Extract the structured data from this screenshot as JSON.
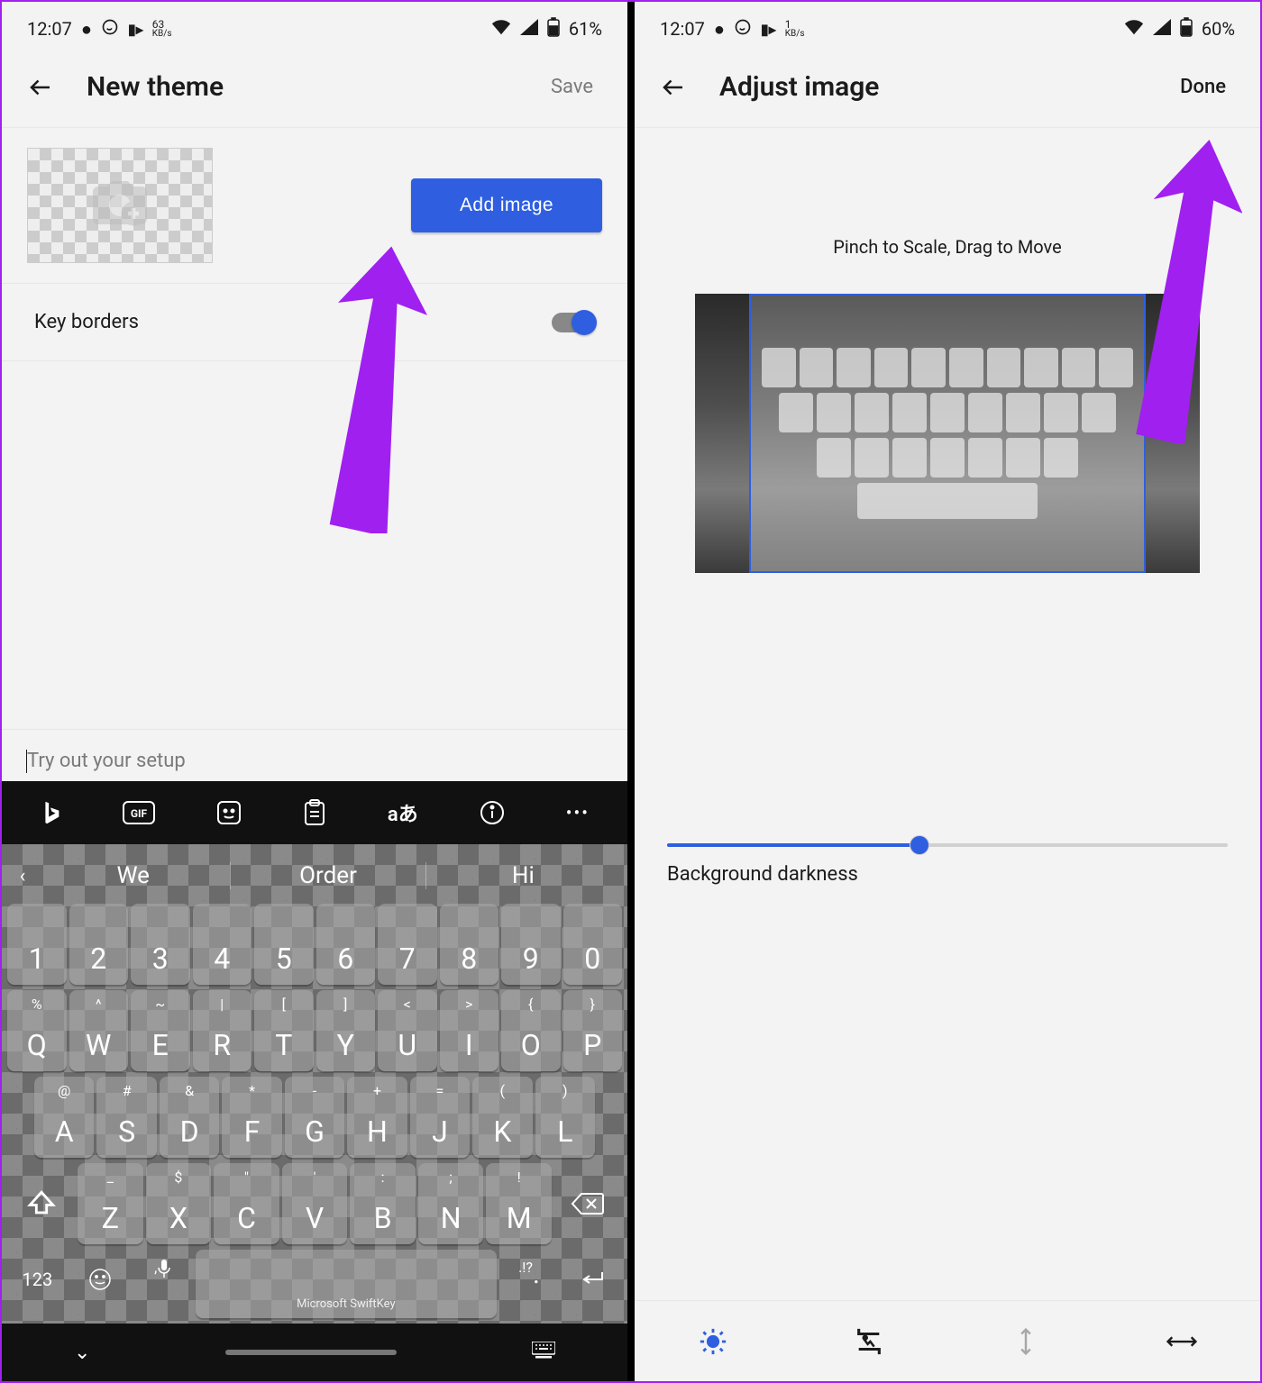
{
  "left": {
    "status": {
      "time": "12:07",
      "speed_top": "63",
      "speed_unit": "KB/s",
      "battery": "61%"
    },
    "appbar": {
      "title": "New theme",
      "action": "Save"
    },
    "addImage": {
      "button": "Add image"
    },
    "keyBorders": {
      "label": "Key borders"
    },
    "tryout": {
      "placeholder": "Try out your setup"
    },
    "suggestions": [
      "We",
      "Order",
      "Hi"
    ],
    "rowNums": [
      "1",
      "2",
      "3",
      "4",
      "5",
      "6",
      "7",
      "8",
      "9",
      "0"
    ],
    "rowQ_sub": [
      "%",
      "^",
      "~",
      "|",
      "[",
      "]",
      "<",
      ">",
      "{",
      "}"
    ],
    "rowQ": [
      "Q",
      "W",
      "E",
      "R",
      "T",
      "Y",
      "U",
      "I",
      "O",
      "P"
    ],
    "rowA_sub": [
      "@",
      "#",
      "&",
      "*",
      "-",
      "+",
      "=",
      "(",
      ")"
    ],
    "rowA": [
      "A",
      "S",
      "D",
      "F",
      "G",
      "H",
      "J",
      "K",
      "L"
    ],
    "rowZ_sub": [
      "_",
      "$",
      "\"",
      "'",
      ":",
      ";",
      "!",
      "?"
    ],
    "rowZ": [
      "Z",
      "X",
      "C",
      "V",
      "B",
      "N",
      "M"
    ],
    "space_brand": "Microsoft SwiftKey",
    "num_label": "123",
    "q_label": ".!?"
  },
  "right": {
    "status": {
      "time": "12:07",
      "speed_top": "1",
      "speed_unit": "KB/s",
      "battery": "60%"
    },
    "appbar": {
      "title": "Adjust image",
      "action": "Done"
    },
    "instruction": "Pinch to Scale, Drag to Move",
    "sliderLabel": "Background darkness"
  }
}
